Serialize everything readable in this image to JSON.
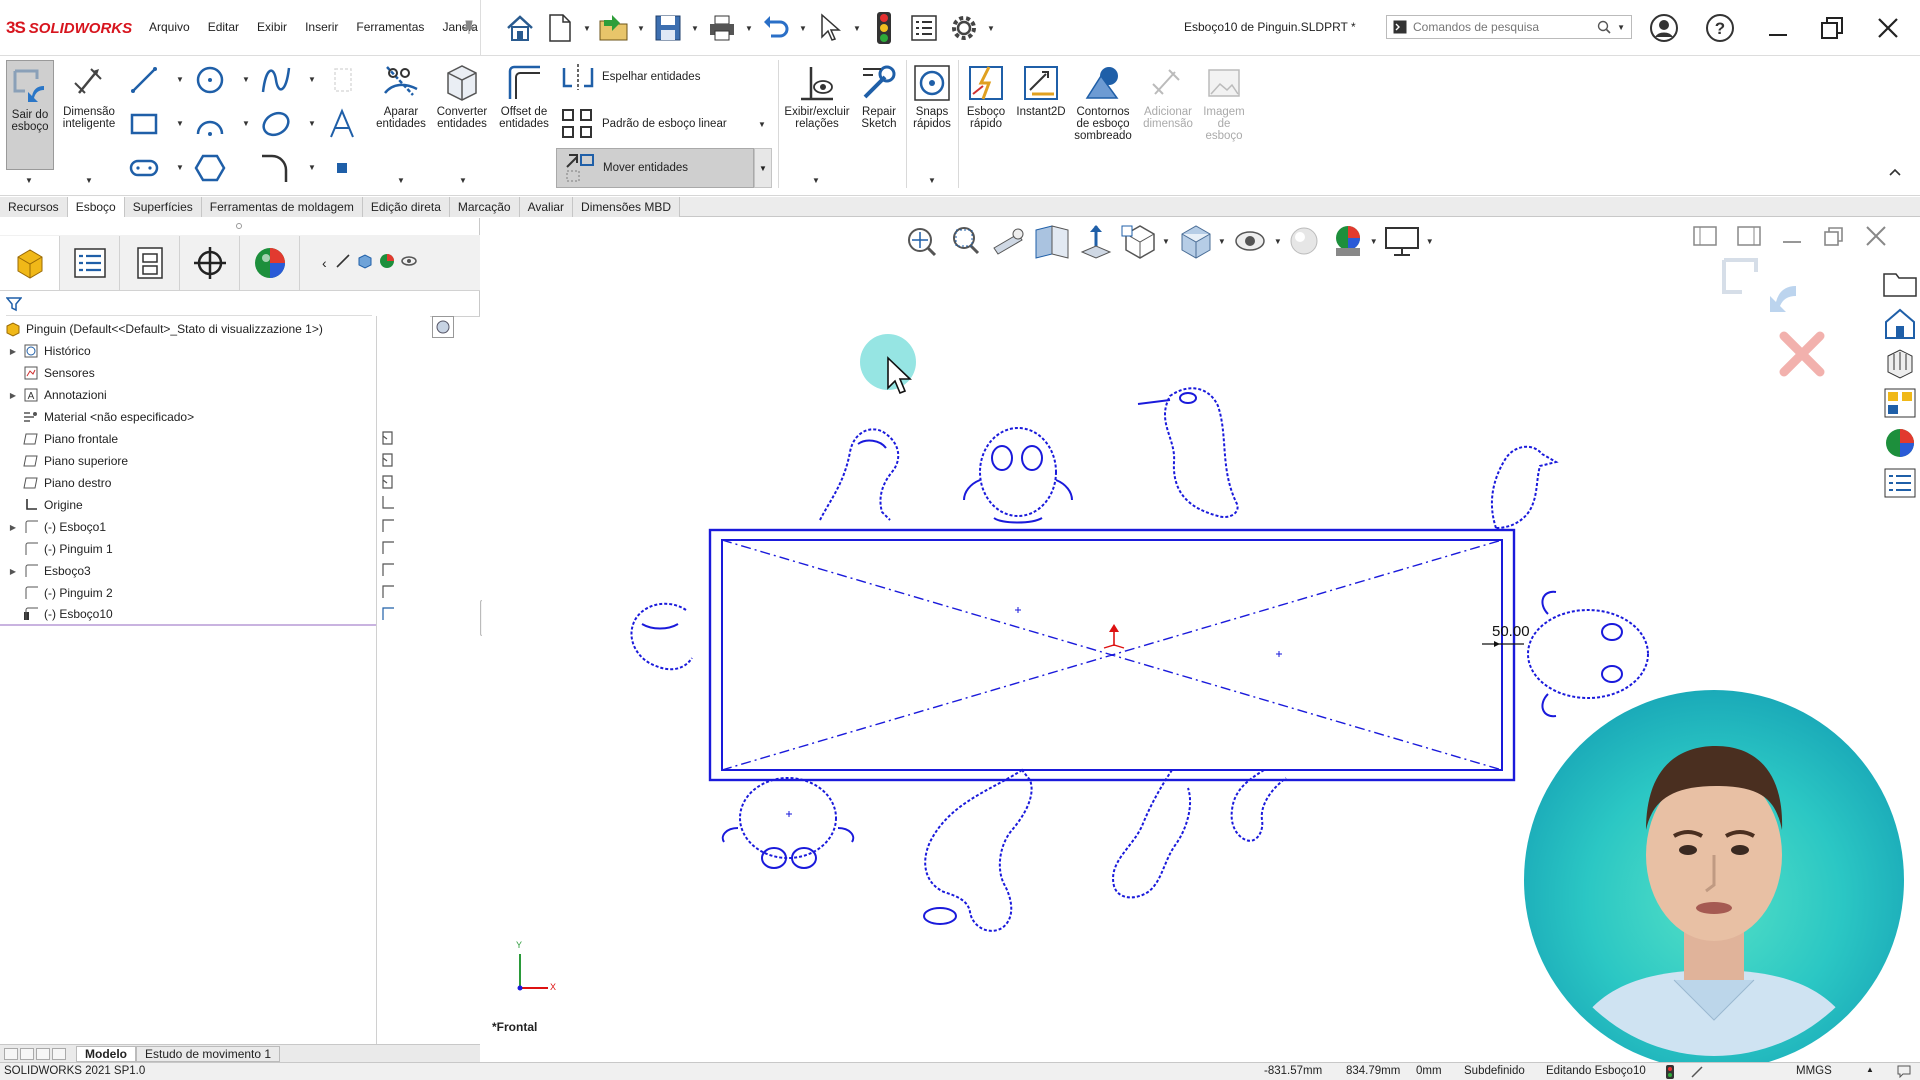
{
  "app": {
    "brand_ds": "3S",
    "brand_name": "SOLIDWORKS"
  },
  "menu": [
    "Arquivo",
    "Editar",
    "Exibir",
    "Inserir",
    "Ferramentas",
    "Janela"
  ],
  "document_title": "Esboço10 de Pinguin.SLDPRT *",
  "search": {
    "placeholder": "Comandos de pesquisa"
  },
  "ribbon": {
    "exit_sketch": "Sair do esboço",
    "smart_dim": "Dimensão inteligente",
    "trim": "Aparar entidades",
    "convert": "Converter entidades",
    "offset": "Offset de entidades",
    "mirror": "Espelhar entidades",
    "linear_pattern": "Padrão de esboço linear",
    "move": "Mover entidades",
    "relations": "Exibir/excluir relações",
    "repair": "Repair Sketch",
    "snaps": "Snaps rápidos",
    "rapid": "Esboço rápido",
    "instant2d": "Instant2D",
    "shaded": "Contornos de esboço sombreado",
    "add_dim": "Adicionar dimensão",
    "sketch_image": "Imagem de esboço"
  },
  "tabs": [
    {
      "label": "Recursos",
      "active": false
    },
    {
      "label": "Esboço",
      "active": true
    },
    {
      "label": "Superfícies",
      "active": false
    },
    {
      "label": "Ferramentas de moldagem",
      "active": false
    },
    {
      "label": "Edição direta",
      "active": false
    },
    {
      "label": "Marcação",
      "active": false
    },
    {
      "label": "Avaliar",
      "active": false
    },
    {
      "label": "Dimensões MBD",
      "active": false
    }
  ],
  "tree": {
    "root": "Pinguin  (Default<<Default>_Stato di visualizzazione 1>)",
    "items": [
      "Histórico",
      "Sensores",
      "Annotazioni",
      "Material <não especificado>",
      "Piano frontale",
      "Piano superiore",
      "Piano destro",
      "Origine",
      "(-) Esboço1",
      "(-) Pinguim 1",
      "Esboço3",
      "(-) Pinguim 2",
      "(-) Esboço10"
    ]
  },
  "graphics": {
    "view_label": "*Frontal",
    "dimension": "50.00",
    "axis_x": "X",
    "axis_y": "Y"
  },
  "bottom_tabs": [
    "Modelo",
    "Estudo de movimento 1"
  ],
  "status": {
    "version": "SOLIDWORKS 2021 SP1.0",
    "x": "-831.57mm",
    "y": "834.79mm",
    "z": "0mm",
    "state": "Subdefinido",
    "editing": "Editando Esboço10",
    "units": "MMGS"
  },
  "colors": {
    "sketch": "#1a1adb",
    "accent": "#d7151e",
    "webcam": "#2bc7c4"
  }
}
